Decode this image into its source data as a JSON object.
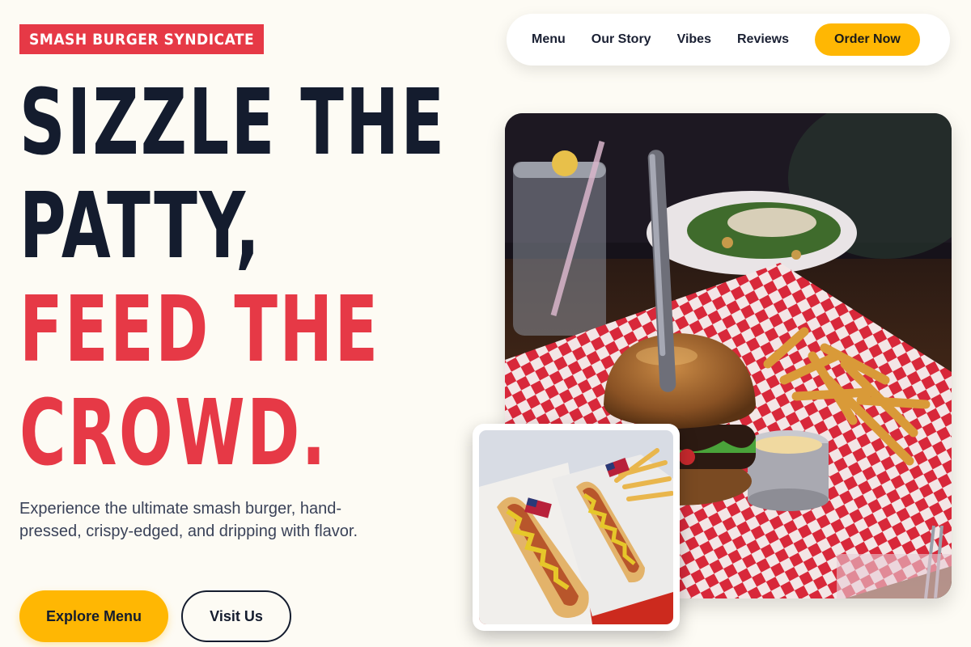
{
  "brand": {
    "name": "SMASH BURGER SYNDICATE"
  },
  "nav": {
    "links": [
      "Menu",
      "Our Story",
      "Vibes",
      "Reviews"
    ],
    "cta": "Order Now"
  },
  "hero": {
    "line1": "SIZZLE THE",
    "line2": "PATTY,",
    "line3": "FEED THE",
    "line4": "CROWD.",
    "description": "Experience the ultimate smash burger, hand-pressed, crispy-edged, and dripping with flavor.",
    "primary_button": "Explore Menu",
    "secondary_button": "Visit Us"
  },
  "colors": {
    "accent_red": "#e63946",
    "accent_yellow": "#ffb703",
    "ink": "#141c2e",
    "background": "#fdfbf4"
  },
  "images": {
    "hero": "burger-fries-photo",
    "inset": "hot-dogs-photo"
  }
}
